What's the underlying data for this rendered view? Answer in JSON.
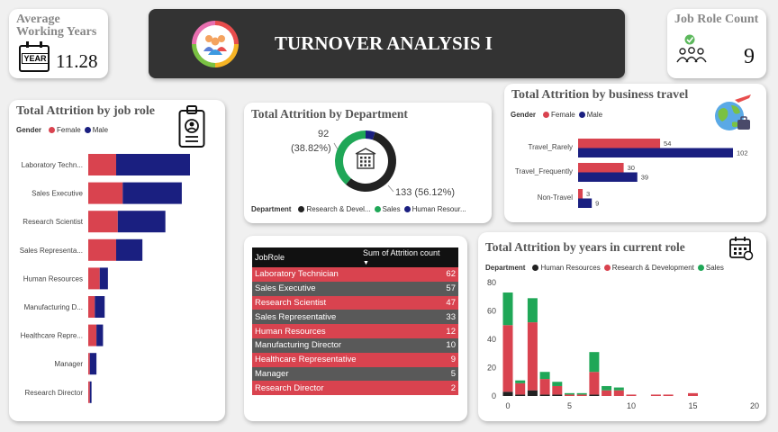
{
  "header": {
    "title": "TURNOVER ANALYSIS I",
    "icon": "team-icon"
  },
  "kpi_years": {
    "label_line1": "Average",
    "label_line2": "Working Years",
    "icon_text": "YEAR",
    "value": "11.28"
  },
  "kpi_roles": {
    "label": "Job Role Count",
    "value": "9"
  },
  "colors": {
    "female": "#d9434f",
    "male": "#1a1f80",
    "hr": "#222222",
    "rnd": "#d9434f",
    "sales": "#1fa757"
  },
  "chart_data": [
    {
      "id": "job_role",
      "type": "bar",
      "title": "Total Attrition by job role",
      "legend_title": "Gender",
      "categories": [
        "Laboratory Techn...",
        "Sales Executive",
        "Research Scientist",
        "Sales Representa...",
        "Human Resources",
        "Manufacturing D...",
        "Healthcare Repre...",
        "Manager",
        "Research Director"
      ],
      "series": [
        {
          "name": "Female",
          "values": [
            17,
            21,
            18,
            17,
            7,
            4,
            5,
            1,
            1
          ]
        },
        {
          "name": "Male",
          "values": [
            45,
            36,
            29,
            16,
            5,
            6,
            4,
            4,
            1
          ]
        }
      ],
      "stacked": true
    },
    {
      "id": "department",
      "type": "pie",
      "title": "Total Attrition by Department",
      "legend_title": "Department",
      "labels": [
        "Research & Devel...",
        "Sales",
        "Human Resour..."
      ],
      "values": [
        133,
        92,
        12
      ],
      "label_sales_value": "92",
      "label_sales_pct": "(38.82%)",
      "label_rnd": "133 (56.12%)"
    },
    {
      "id": "business_travel",
      "type": "bar",
      "title": "Total Attrition by business travel",
      "legend_title": "Gender",
      "categories": [
        "Travel_Rarely",
        "Travel_Frequently",
        "Non-Travel"
      ],
      "series": [
        {
          "name": "Female",
          "values": [
            54,
            30,
            3
          ]
        },
        {
          "name": "Male",
          "values": [
            102,
            39,
            9
          ]
        }
      ]
    },
    {
      "id": "years_in_role",
      "type": "bar",
      "title": "Total Attrition by years in current role",
      "legend_title": "Department",
      "x": [
        0,
        1,
        2,
        3,
        4,
        5,
        6,
        7,
        8,
        9,
        10,
        11,
        12,
        13,
        14,
        15
      ],
      "series": [
        {
          "name": "Human Resources",
          "values": [
            3,
            1,
            4,
            1,
            1,
            0,
            0,
            1,
            0,
            0,
            0,
            0,
            0,
            0,
            0,
            0
          ]
        },
        {
          "name": "Research & Development",
          "values": [
            47,
            8,
            48,
            11,
            6,
            1,
            1,
            16,
            4,
            4,
            1,
            0,
            1,
            1,
            0,
            2
          ]
        },
        {
          "name": "Sales",
          "values": [
            23,
            2,
            17,
            5,
            3,
            1,
            1,
            14,
            3,
            2,
            0,
            0,
            0,
            0,
            0,
            0
          ]
        }
      ],
      "xlim": [
        0,
        20
      ],
      "ylim": [
        0,
        80
      ],
      "xticks": [
        0,
        5,
        10,
        15,
        20
      ],
      "yticks": [
        0,
        20,
        40,
        60,
        80
      ],
      "stacked": true
    }
  ],
  "table": {
    "headers": [
      "JobRole",
      "Sum of Attrition count"
    ],
    "rows": [
      [
        "Laboratory Technician",
        "62"
      ],
      [
        "Sales Executive",
        "57"
      ],
      [
        "Research Scientist",
        "47"
      ],
      [
        "Sales Representative",
        "33"
      ],
      [
        "Human Resources",
        "12"
      ],
      [
        "Manufacturing Director",
        "10"
      ],
      [
        "Healthcare Representative",
        "9"
      ],
      [
        "Manager",
        "5"
      ],
      [
        "Research Director",
        "2"
      ]
    ]
  }
}
